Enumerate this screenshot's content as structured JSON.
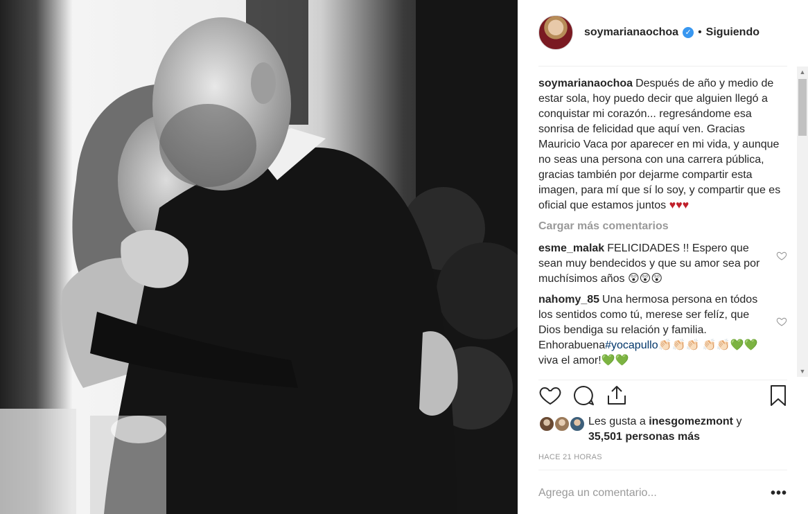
{
  "post": {
    "author": "soymarianaochoa",
    "separator": "•",
    "follow_status": "Siguiendo",
    "verified_mark": "✓"
  },
  "caption": {
    "user": "soymarianaochoa",
    "text": "Después de año y medio de estar sola, hoy puedo decir que alguien llegó a conquistar mi corazón... regresándome esa sonrisa de felicidad que aquí ven. Gracias Mauricio Vaca por aparecer en mi vida, y aunque no seas una persona con una carrera pública, gracias también por dejarme compartir esta imagen, para mí que sí lo soy, y compartir que es oficial que estamos juntos",
    "emoji": "♥♥♥"
  },
  "load_more": "Cargar más comentarios",
  "comments": [
    {
      "user": "esme_malak",
      "text": "FELICIDADES !! Espero que sean muy bendecidos y que su amor sea por muchísimos años",
      "emoji": "😲😲😲"
    },
    {
      "user": "nahomy_85",
      "text": "Una hermosa persona en tódos los sentidos como tú, merese ser felíz, que Dios bendiga su relación y familia. Enhorabuena",
      "hashtag": "#yocapullo",
      "emoji": "👏🏻👏🏻👏🏻",
      "tail": "👏🏻👏🏻💚💚 viva el amor!💚💚"
    }
  ],
  "likes": {
    "prefix": "Les gusta a",
    "user": "inesgomezmont",
    "conj": "y",
    "count_text": "35,501 personas más"
  },
  "timestamp": "HACE 21 HORAS",
  "add_comment": {
    "placeholder": "Agrega un comentario...",
    "more": "•••"
  },
  "icons": [
    "heart-icon",
    "comment-icon",
    "share-icon",
    "bookmark-icon",
    "options-icon"
  ],
  "colors": {
    "text": "#262626",
    "muted": "#999999",
    "hearts": "#c0202b",
    "verified": "#3897f0",
    "hashtag": "#003569"
  }
}
